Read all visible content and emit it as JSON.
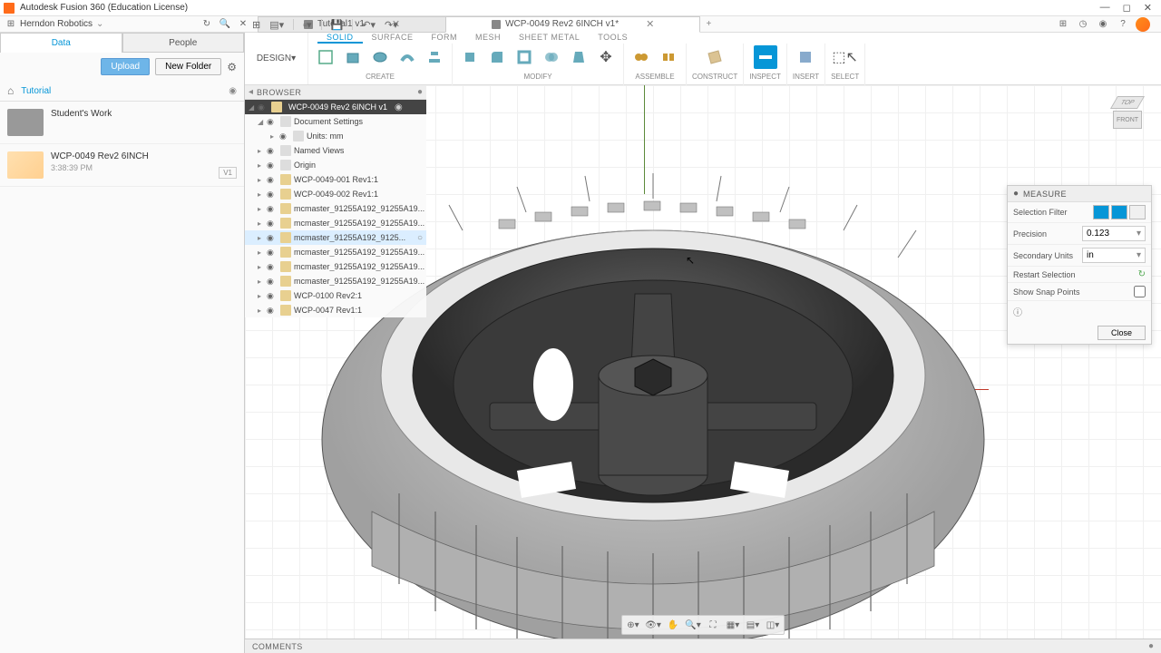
{
  "app": {
    "title": "Autodesk Fusion 360 (Education License)"
  },
  "team": {
    "name": "Herndon Robotics"
  },
  "tabs": [
    {
      "label": "Tutorial1 v1",
      "active": false
    },
    {
      "label": "WCP-0049 Rev2 6INCH v1*",
      "active": true
    }
  ],
  "ribbon": {
    "workspace": "DESIGN",
    "tabs": [
      "SOLID",
      "SURFACE",
      "FORM",
      "MESH",
      "SHEET METAL",
      "TOOLS"
    ],
    "active_tab": "SOLID",
    "groups": [
      "CREATE",
      "MODIFY",
      "ASSEMBLE",
      "CONSTRUCT",
      "INSPECT",
      "INSERT",
      "SELECT"
    ]
  },
  "leftpanel": {
    "tabs": [
      "Data",
      "People"
    ],
    "active": "Data",
    "upload": "Upload",
    "newfolder": "New Folder",
    "breadcrumb": [
      "Tutorial"
    ],
    "items": [
      {
        "name": "Student's Work",
        "type": "folder"
      },
      {
        "name": "WCP-0049 Rev2 6INCH",
        "time": "3:38:39 PM",
        "type": "part",
        "ver": "V1"
      }
    ]
  },
  "browser": {
    "title": "BROWSER",
    "root": "WCP-0049 Rev2 6INCH v1",
    "nodes": [
      {
        "label": "Document Settings",
        "depth": 1,
        "exp": true
      },
      {
        "label": "Units: mm",
        "depth": 2
      },
      {
        "label": "Named Views",
        "depth": 1
      },
      {
        "label": "Origin",
        "depth": 1
      },
      {
        "label": "WCP-0049-001 Rev1:1",
        "depth": 1,
        "comp": true
      },
      {
        "label": "WCP-0049-002 Rev1:1",
        "depth": 1,
        "comp": true
      },
      {
        "label": "mcmaster_91255A192_91255A19...",
        "depth": 1,
        "comp": true
      },
      {
        "label": "mcmaster_91255A192_91255A19...",
        "depth": 1,
        "comp": true
      },
      {
        "label": "mcmaster_91255A192_9125...",
        "depth": 1,
        "comp": true,
        "sel": true
      },
      {
        "label": "mcmaster_91255A192_91255A19...",
        "depth": 1,
        "comp": true
      },
      {
        "label": "mcmaster_91255A192_91255A19...",
        "depth": 1,
        "comp": true
      },
      {
        "label": "mcmaster_91255A192_91255A19...",
        "depth": 1,
        "comp": true
      },
      {
        "label": "WCP-0100 Rev2:1",
        "depth": 1,
        "comp": true
      },
      {
        "label": "WCP-0047 Rev1:1",
        "depth": 1,
        "comp": true
      }
    ]
  },
  "measure": {
    "title": "MEASURE",
    "rows": {
      "filter": "Selection Filter",
      "precision": {
        "label": "Precision",
        "value": "0.123"
      },
      "units": {
        "label": "Secondary Units",
        "value": "in"
      },
      "restart": "Restart Selection",
      "snap": "Show Snap Points"
    },
    "close": "Close"
  },
  "viewcube": {
    "top": "TOP",
    "front": "FRONT"
  },
  "comments": "COMMENTS"
}
